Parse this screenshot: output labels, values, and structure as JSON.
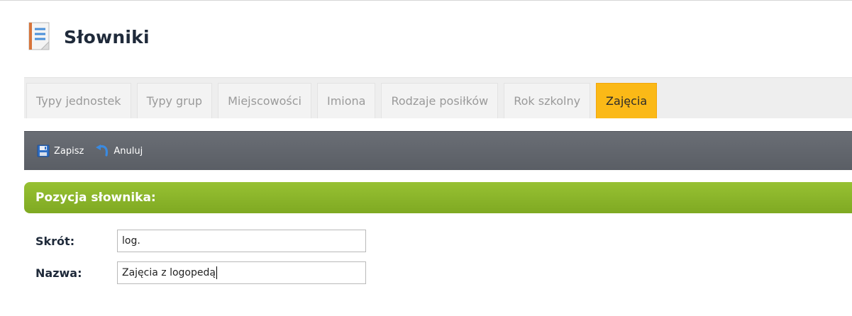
{
  "header": {
    "title": "Słowniki",
    "icon": "notebook-icon"
  },
  "tabs": [
    {
      "label": "Typy jednostek",
      "active": false
    },
    {
      "label": "Typy grup",
      "active": false
    },
    {
      "label": "Miejscowości",
      "active": false
    },
    {
      "label": "Imiona",
      "active": false
    },
    {
      "label": "Rodzaje posiłków",
      "active": false
    },
    {
      "label": "Rok szkolny",
      "active": false
    },
    {
      "label": "Zajęcia",
      "active": true
    }
  ],
  "toolbar": {
    "save_label": "Zapisz",
    "save_icon": "floppy-disk-icon",
    "cancel_label": "Anuluj",
    "cancel_icon": "undo-arrow-icon"
  },
  "section": {
    "title": "Pozycja słownika:"
  },
  "form": {
    "short_label": "Skrót:",
    "short_value": "log.",
    "name_label": "Nazwa:",
    "name_value": "Zajęcia z logopedą"
  },
  "colors": {
    "active_tab": "#fbb917",
    "toolbar": "#63676e",
    "section_header": "#8bb52b"
  }
}
